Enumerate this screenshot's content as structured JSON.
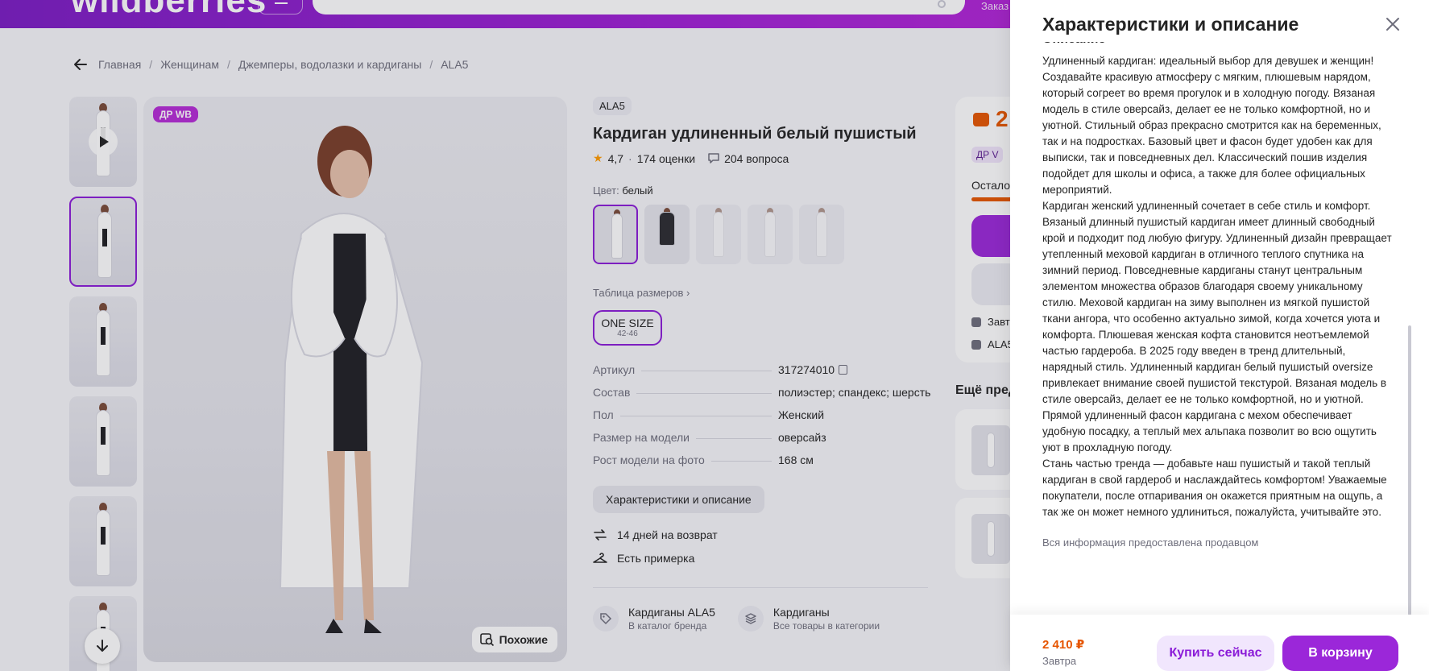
{
  "header": {
    "logo": "wildberries",
    "orders_label": "Заказ"
  },
  "breadcrumb": [
    "Главная",
    "Женщинам",
    "Джемперы, водолазки и кардиганы",
    "ALA5"
  ],
  "gallery": {
    "badge": "ДР WB",
    "similar_label": "Похожие"
  },
  "product": {
    "brand": "ALA5",
    "title": "Кардиган удлиненный белый пушистый",
    "rating": "4,7",
    "reviews": "174 оценки",
    "questions": "204 вопроса",
    "color_label": "Цвет:",
    "color_value": "белый",
    "size_table_label": "Таблица размеров",
    "size_name": "ONE SIZE",
    "size_range": "42-46",
    "params": [
      {
        "k": "Артикул",
        "v": "317274010"
      },
      {
        "k": "Состав",
        "v": "полиэстер; спандекс; шерсть"
      },
      {
        "k": "Пол",
        "v": "Женский"
      },
      {
        "k": "Размер на модели",
        "v": "оверсайз"
      },
      {
        "k": "Рост модели на фото",
        "v": "168 см"
      }
    ],
    "char_button": "Характеристики и описание",
    "features": [
      "14 дней на возврат",
      "Есть примерка"
    ],
    "brand_links": [
      {
        "title": "Кардиганы ALA5",
        "sub": "В каталог бренда"
      },
      {
        "title": "Кардиганы",
        "sub": "Все товары в категории"
      }
    ]
  },
  "buy_box": {
    "price_partial": "2",
    "dr_partial": "ДР V",
    "left_partial": "Остало",
    "delivery_partial": "Завт",
    "seller_partial": "ALA5",
    "more_title": "Ещё пред"
  },
  "panel": {
    "title": "Характеристики и описание",
    "section": "Описание",
    "description": [
      "Удлиненный кардиган: идеальный выбор для девушек и женщин! Создавайте красивую атмосферу с мягким, плюшевым нарядом, который согреет во время прогулок и в холодную погоду. Вязаная модель в стиле оверсайз, делает ее не только комфортной, но и уютной. Стильный образ прекрасно смотрится как на беременных, так и на подростках. Базовый цвет и фасон будет удобен как для выписки, так и повседневных дел. Классический пошив изделия подойдет для школы и офиса, а также для более официальных мероприятий.",
      "Кардиган женский удлиненный сочетает в себе стиль и комфорт. Вязаный длинный пушистый кардиган имеет длинный свободный крой и подходит под любую фигуру. Удлиненный дизайн превращает утепленный меховой кардиган в отличного теплого спутника на зимний период. Повседневные кардиганы станут центральным элементом множества образов благодаря своему уникальному стилю. Меховой кардиган на зиму выполнен из мягкой пушистой ткани ангора, что особенно актуально зимой, когда хочется уюта и комфорта. Плюшевая женская кофта становится неотъемлемой частью гардероба. В 2025 году введен в тренд длительный, нарядный стиль. Удлиненный кардиган белый пушистый oversize привлекает внимание своей пушистой текстурой. Вязаная модель в стиле оверсайз, делает ее не только комфортной, но и уютной. Прямой удлиненный фасон кардигана с мехом обеспечивает удобную посадку, а теплый мех альпака позволит во всю ощутить уют в прохладную погоду.",
      "Стань частью тренда — добавьте наш пушистый и такой теплый кардиган в свой гардероб и наслаждайтесь комфортом! Уважаемые покупатели, после отпаривания он окажется приятным на ощупь, а так же он может немного удлиниться, пожалуйста, учитывайте это."
    ],
    "seller_note": "Вся информация предоставлена продавцом",
    "footer_price": "2 410 ₽",
    "footer_when": "Завтра",
    "buy_now": "Купить сейчас",
    "add_to_cart": "В корзину"
  },
  "colors": {
    "accent": "#9b27d9",
    "price": "#e65500"
  }
}
